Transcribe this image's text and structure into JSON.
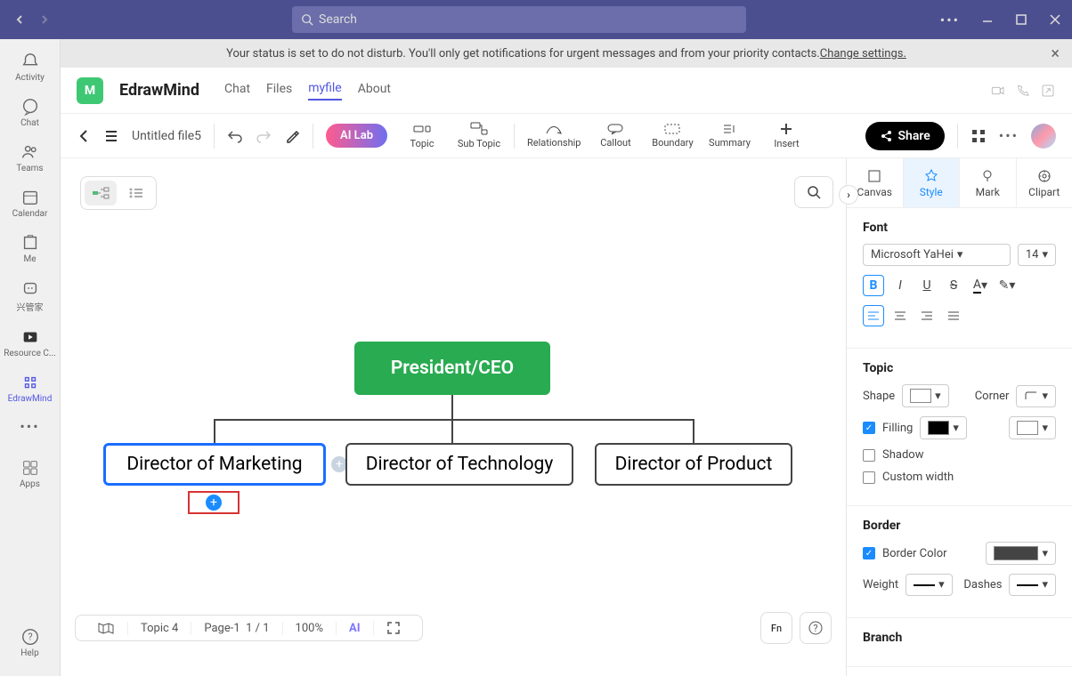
{
  "search_placeholder": "Search",
  "notification": {
    "text": "Your status is set to do not disturb. You'll only get notifications for urgent messages and from your priority contacts. ",
    "link": "Change settings."
  },
  "rail": {
    "activity": "Activity",
    "chat": "Chat",
    "teams": "Teams",
    "calendar": "Calendar",
    "me": "Me",
    "xingguanjia": "兴管家",
    "resource": "Resource C...",
    "edrawmind": "EdrawMind",
    "apps": "Apps",
    "help": "Help"
  },
  "app": {
    "name": "EdrawMind",
    "tabs": {
      "chat": "Chat",
      "files": "Files",
      "myfile": "myfile",
      "about": "About"
    }
  },
  "toolbar": {
    "file_name": "Untitled file5",
    "ai_lab": "AI Lab",
    "topic": "Topic",
    "subtopic": "Sub Topic",
    "relationship": "Relationship",
    "callout": "Callout",
    "boundary": "Boundary",
    "summary": "Summary",
    "insert": "Insert",
    "share": "Share"
  },
  "canvas": {
    "root": "President/CEO",
    "child1": "Director of Marketing",
    "child2": "Director of Technology",
    "child3": "Director of Product"
  },
  "status": {
    "topic": "Topic 4",
    "page_label": "Page-1",
    "page_num": "1 / 1",
    "zoom": "100%"
  },
  "rpanel": {
    "tab_canvas": "Canvas",
    "tab_style": "Style",
    "tab_mark": "Mark",
    "tab_clipart": "Clipart",
    "font_title": "Font",
    "font_family": "Microsoft YaHei",
    "font_size": "14",
    "topic_title": "Topic",
    "shape": "Shape",
    "corner": "Corner",
    "filling": "Filling",
    "shadow": "Shadow",
    "custom_width": "Custom width",
    "border_title": "Border",
    "border_color": "Border Color",
    "weight": "Weight",
    "dashes": "Dashes",
    "branch_title": "Branch"
  }
}
